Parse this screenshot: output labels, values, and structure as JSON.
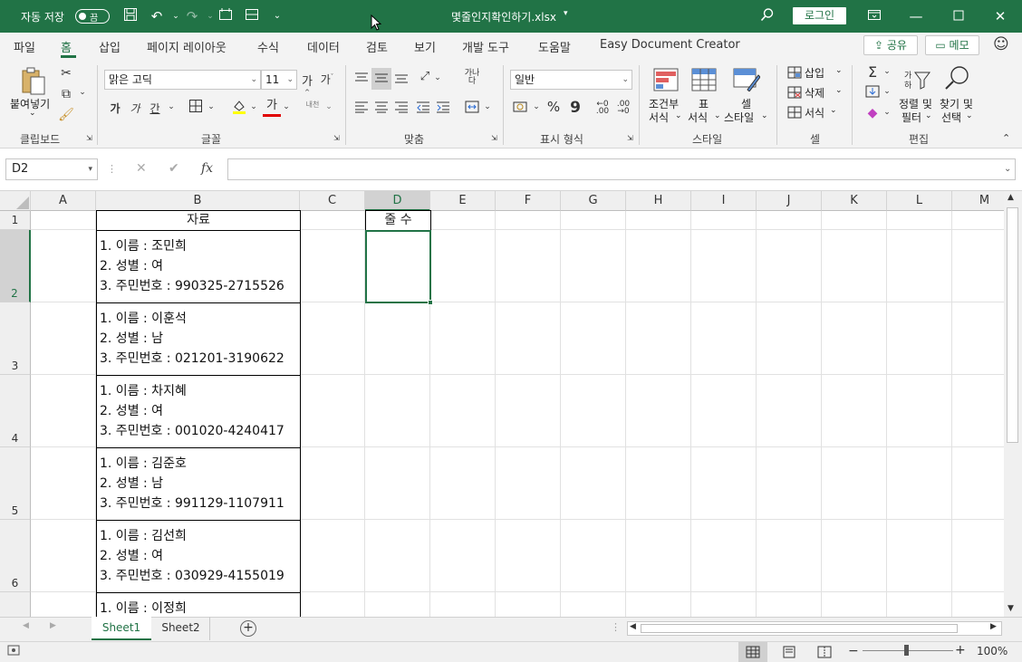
{
  "titlebar": {
    "autosave_label": "자동 저장",
    "autosave_state": "끔",
    "filename": "몇줄인지확인하기.xlsx",
    "login_label": "로그인"
  },
  "menu": {
    "items": [
      "파일",
      "홈",
      "삽입",
      "페이지 레이아웃",
      "수식",
      "데이터",
      "검토",
      "보기",
      "개발 도구",
      "도움말",
      "Easy Document Creator"
    ],
    "share_label": "공유",
    "memo_label": "메모"
  },
  "ribbon": {
    "paste_label": "붙여넣기",
    "clipboard_label": "클립보드",
    "font_name": "맑은 고딕",
    "font_size": "11",
    "font_group_label": "글꼴",
    "align_group_label": "맞춤",
    "number_format": "일반",
    "number_group_label": "표시 형식",
    "cond_format_label": "조건부",
    "cond_format_label2": "서식",
    "table_label": "표",
    "table_label2": "서식",
    "cell_style_label": "셀",
    "cell_style_label2": "스타일",
    "style_group_label": "스타일",
    "insert_label": "삽입",
    "delete_label": "삭제",
    "format_label": "서식",
    "cells_group_label": "셀",
    "sort_label": "정렬 및",
    "sort_label2": "필터",
    "find_label": "찾기 및",
    "find_label2": "선택",
    "edit_group_label": "편집"
  },
  "formula": {
    "name_box": "D2",
    "fx_label": "fx"
  },
  "grid": {
    "columns": [
      "A",
      "B",
      "C",
      "D",
      "E",
      "F",
      "G",
      "H",
      "I",
      "J",
      "K",
      "L",
      "M"
    ],
    "rows": [
      "1",
      "2",
      "3",
      "4",
      "5",
      "6"
    ],
    "header_b1": "자료",
    "header_d1": "줄 수",
    "records": [
      [
        "1. 이름 : 조민희",
        "2. 성별 : 여",
        "3. 주민번호 : 990325-2715526"
      ],
      [
        "1. 이름 : 이훈석",
        "2. 성별 : 남",
        "3. 주민번호 : 021201-3190622"
      ],
      [
        "1. 이름 : 차지혜",
        "2. 성별 : 여",
        "3. 주민번호 : 001020-4240417"
      ],
      [
        "1. 이름 : 김준호",
        "2. 성별 : 남",
        "3. 주민번호 : 991129-1107911"
      ],
      [
        "1. 이름 : 김선희",
        "2. 성별 : 여",
        "3. 주민번호 : 030929-4155019"
      ],
      [
        "1. 이름 : 이정희"
      ]
    ]
  },
  "sheets": [
    "Sheet1",
    "Sheet2"
  ],
  "status": {
    "zoom": "100%"
  }
}
